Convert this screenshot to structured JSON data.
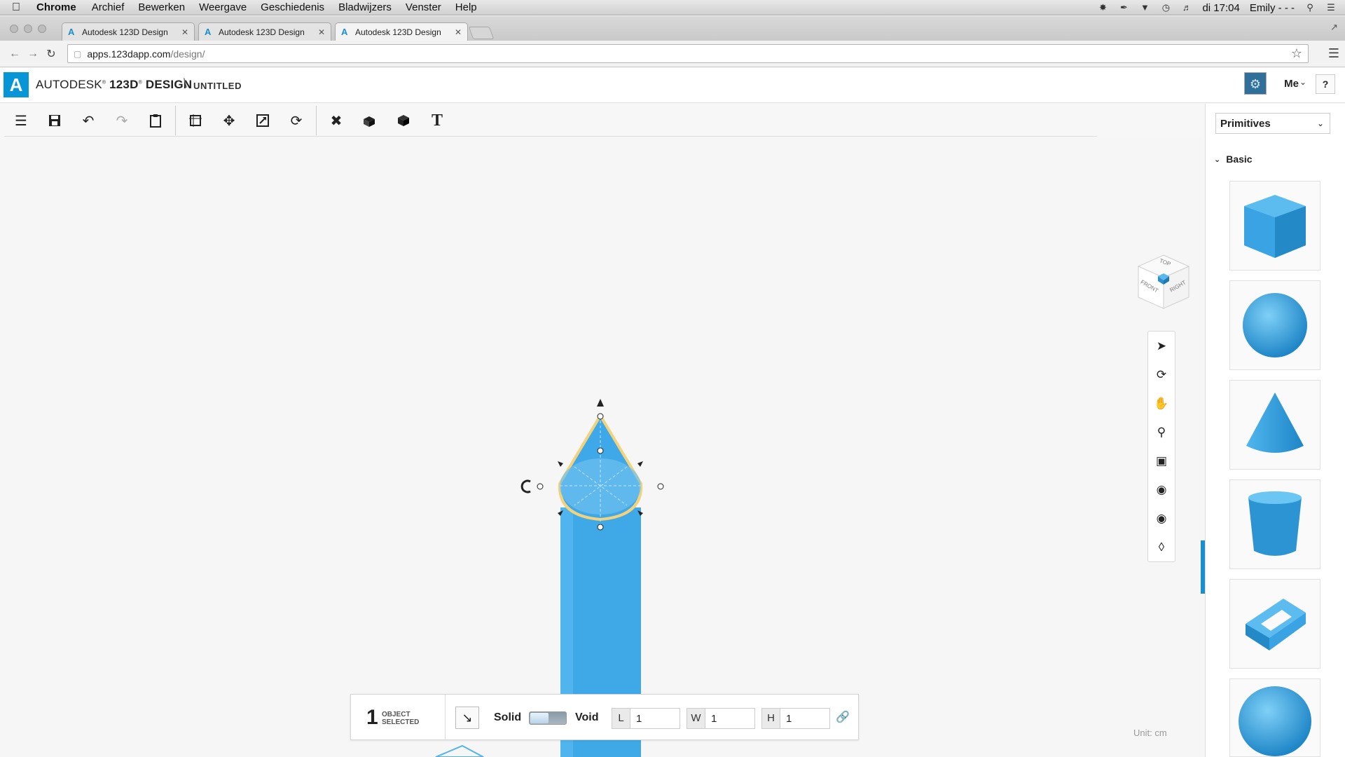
{
  "mac_menu": {
    "app_name": "Chrome",
    "items": [
      "Archief",
      "Bewerken",
      "Weergave",
      "Geschiedenis",
      "Bladwijzers",
      "Venster",
      "Help"
    ],
    "clock": "di 17:04",
    "user": "Emily - - -"
  },
  "browser": {
    "tabs": [
      {
        "title": "Autodesk 123D Design"
      },
      {
        "title": "Autodesk 123D Design"
      },
      {
        "title": "Autodesk 123D Design"
      }
    ],
    "url_host": "apps.123dapp.com",
    "url_path": "/design/"
  },
  "app": {
    "brand_prefix": "AUTODESK",
    "brand_product": "123D",
    "brand_suffix": "DESIGN",
    "separator": "\\",
    "doc_title": "UNTITLED",
    "user_label": "Me",
    "help_label": "?"
  },
  "toolbar": {
    "icons": [
      "menu-icon",
      "save-icon",
      "undo-icon",
      "redo-icon",
      "clipboard-icon",
      "snap-icon",
      "move-icon",
      "scale-icon",
      "refresh-icon",
      "modify-icon",
      "construct-icon",
      "group-icon",
      "text-icon"
    ]
  },
  "selection": {
    "count": "1",
    "label_line1": "OBJECT",
    "label_line2": "SELECTED",
    "solid_label": "Solid",
    "void_label": "Void",
    "length_key": "L",
    "length_value": "1",
    "width_key": "W",
    "width_value": "1",
    "height_key": "H",
    "height_value": "1"
  },
  "viewcube": {
    "top": "TOP",
    "front": "FRONT",
    "right": "RIGHT"
  },
  "unit": "Unit:  cm",
  "primitives": {
    "dropdown_value": "Primitives",
    "section": "Basic",
    "items": [
      "box",
      "sphere",
      "cone",
      "cylinder",
      "torus-polygon",
      "hemisphere"
    ]
  },
  "colors": {
    "accent": "#1a8ecf",
    "shape_fill": "#3fa9e8",
    "selection_outline": "#f2d27a"
  }
}
